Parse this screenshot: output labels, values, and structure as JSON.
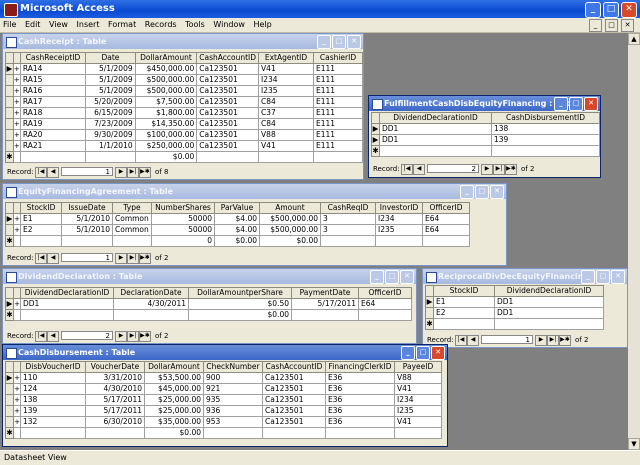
{
  "app": {
    "title": "Microsoft Access"
  },
  "menu": [
    "File",
    "Edit",
    "View",
    "Insert",
    "Format",
    "Records",
    "Tools",
    "Window",
    "Help"
  ],
  "status": "Datasheet View",
  "cashReceipt": {
    "title": "CashReceipt : Table",
    "cols": [
      "CashReceiptID",
      "Date",
      "DollarAmount",
      "CashAccountID",
      "ExtAgentID",
      "CashierID"
    ],
    "rows": [
      [
        "RA14",
        "5/1/2009",
        "$450,000.00",
        "Ca123501",
        "V41",
        "E111"
      ],
      [
        "RA15",
        "5/1/2009",
        "$500,000.00",
        "Ca123501",
        "I234",
        "E111"
      ],
      [
        "RA16",
        "5/1/2009",
        "$500,000.00",
        "Ca123501",
        "I235",
        "E111"
      ],
      [
        "RA17",
        "5/20/2009",
        "$7,500.00",
        "Ca123501",
        "C84",
        "E111"
      ],
      [
        "RA18",
        "6/15/2009",
        "$1,800.00",
        "Ca123501",
        "C37",
        "E111"
      ],
      [
        "RA19",
        "7/23/2009",
        "$14,350.00",
        "Ca123501",
        "C84",
        "E111"
      ],
      [
        "RA20",
        "9/30/2009",
        "$100,000.00",
        "Ca123501",
        "V88",
        "E111"
      ],
      [
        "RA21",
        "1/1/2010",
        "$250,000.00",
        "Ca123501",
        "V41",
        "E111"
      ]
    ],
    "newrow": [
      "",
      "",
      "$0.00",
      "",
      "",
      ""
    ],
    "nav": {
      "label": "Record:",
      "current": "1",
      "of": "of 8"
    }
  },
  "fulfill": {
    "title": "FulfillmentCashDisbEquityFinancing : Table",
    "cols": [
      "DividendDeclarationID",
      "CashDisbursementID"
    ],
    "rows": [
      [
        "DD1",
        "138"
      ],
      [
        "DD1",
        "139"
      ]
    ],
    "nav": {
      "label": "Record:",
      "current": "2",
      "of": "of 2"
    }
  },
  "equity": {
    "title": "EquityFinancingAgreement : Table",
    "cols": [
      "StockID",
      "IssueDate",
      "Type",
      "NumberShares",
      "ParValue",
      "Amount",
      "CashReqID",
      "InvestorID",
      "OfficerID"
    ],
    "rows": [
      [
        "E1",
        "5/1/2010",
        "Common",
        "50000",
        "$4.00",
        "$500,000.00",
        "3",
        "I234",
        "E64"
      ],
      [
        "E2",
        "5/1/2010",
        "Common",
        "50000",
        "$4.00",
        "$500,000.00",
        "3",
        "I235",
        "E64"
      ]
    ],
    "newrow": [
      "",
      "",
      "",
      "0",
      "$0.00",
      "$0.00",
      "",
      "",
      ""
    ],
    "nav": {
      "label": "Record:",
      "current": "1",
      "of": "of 2"
    }
  },
  "dividend": {
    "title": "DividendDeclaration : Table",
    "cols": [
      "DividendDeclarationID",
      "DeclarationDate",
      "DollarAmountperShare",
      "PaymentDate",
      "OfficerID"
    ],
    "rows": [
      [
        "DD1",
        "4/30/2011",
        "$0.50",
        "5/17/2011",
        "E64"
      ]
    ],
    "newrow": [
      "",
      "",
      "$0.00",
      "",
      ""
    ],
    "nav": {
      "label": "Record:",
      "current": "2",
      "of": "of 2"
    }
  },
  "reciprocal": {
    "title": "ReciprocalDivDecEquityFinancing : Table",
    "cols": [
      "StockID",
      "DividendDeclarationID"
    ],
    "rows": [
      [
        "E1",
        "DD1"
      ],
      [
        "E2",
        "DD1"
      ]
    ],
    "nav": {
      "label": "Record:",
      "current": "1",
      "of": "of 2"
    }
  },
  "cashDisb": {
    "title": "CashDisbursement : Table",
    "cols": [
      "DisbVoucherID",
      "VoucherDate",
      "DollarAmount",
      "CheckNumber",
      "CashAccountID",
      "FinancingClerkID",
      "PayeeID"
    ],
    "rows": [
      [
        "110",
        "3/31/2010",
        "$53,500.00",
        "900",
        "Ca123501",
        "E36",
        "V88"
      ],
      [
        "124",
        "4/30/2010",
        "$45,000.00",
        "921",
        "Ca123501",
        "E36",
        "V41"
      ],
      [
        "138",
        "5/17/2011",
        "$25,000.00",
        "935",
        "Ca123501",
        "E36",
        "I234"
      ],
      [
        "139",
        "5/17/2011",
        "$25,000.00",
        "936",
        "Ca123501",
        "E36",
        "I235"
      ],
      [
        "132",
        "6/30/2010",
        "$35,000.00",
        "953",
        "Ca123501",
        "E36",
        "V41"
      ]
    ],
    "newrow": [
      "",
      "",
      "$0.00",
      "",
      "",
      "",
      ""
    ]
  }
}
